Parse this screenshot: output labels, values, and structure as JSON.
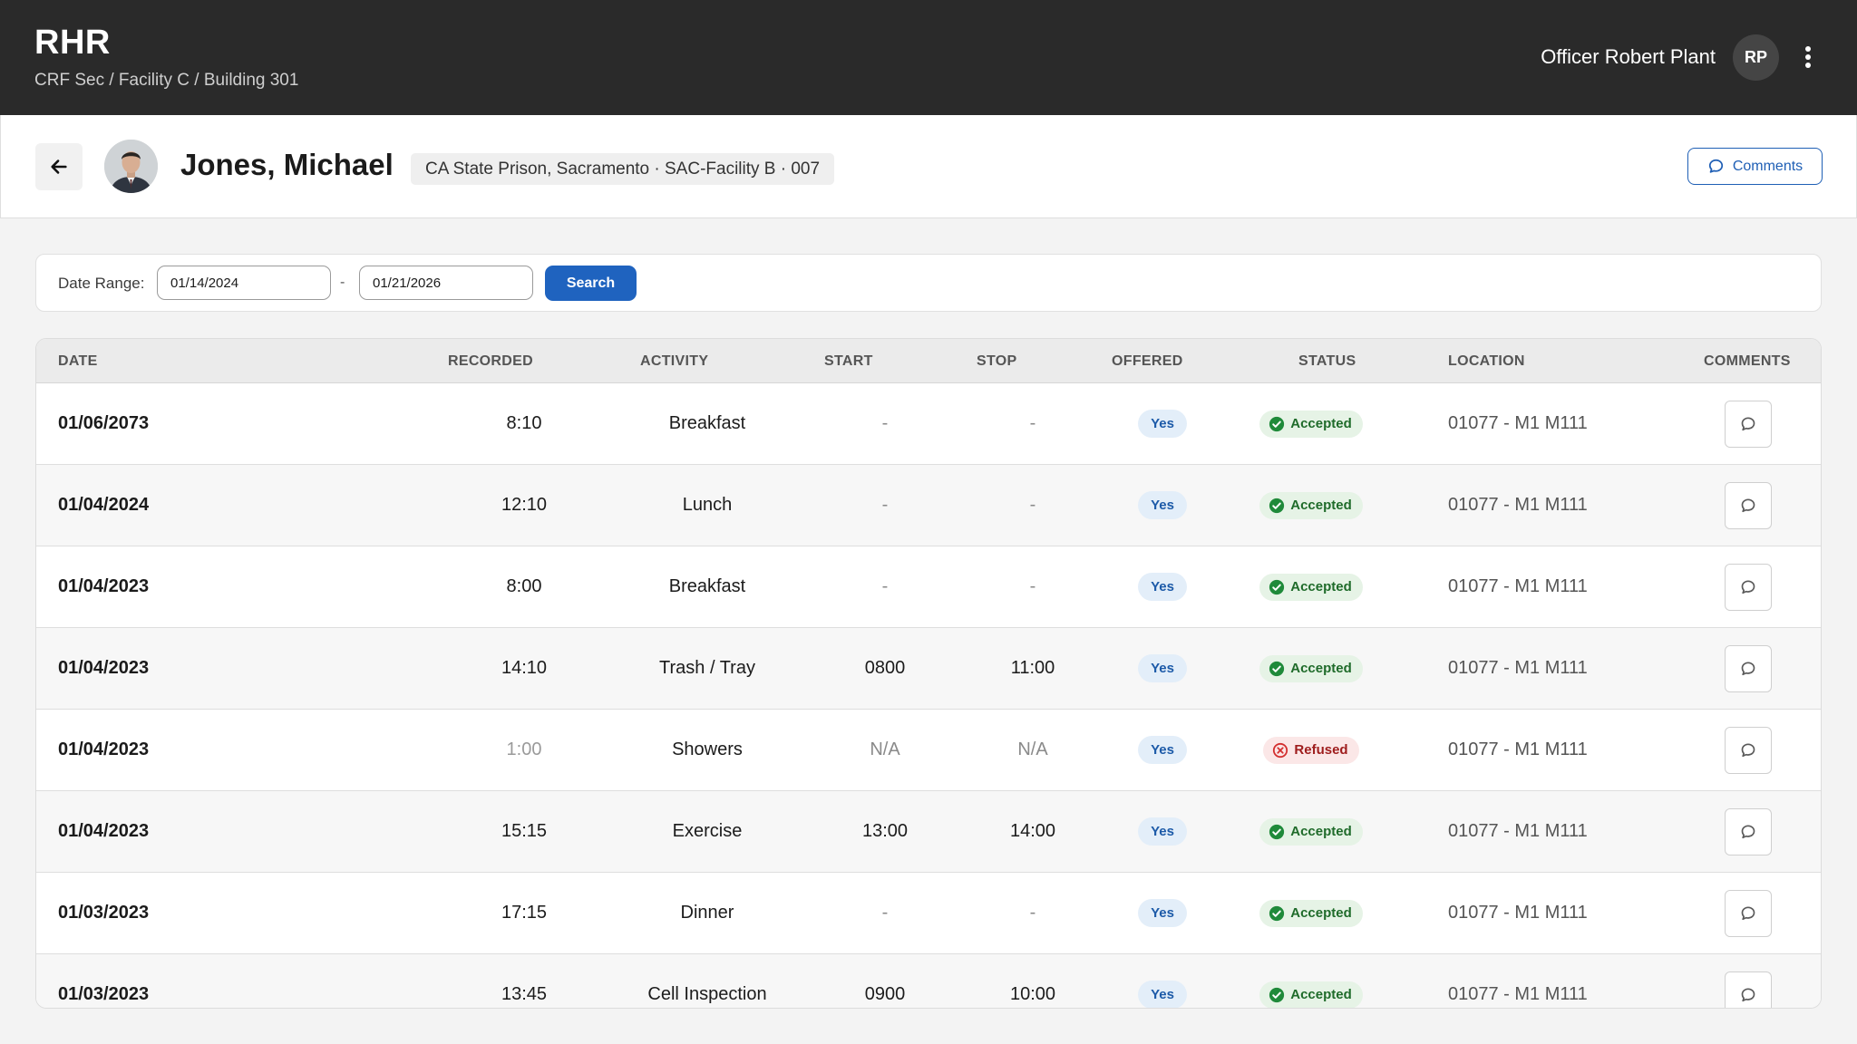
{
  "app": {
    "title": "RHR",
    "breadcrumb": "CRF Sec / Facility C / Building 301",
    "user_name": "Officer Robert Plant",
    "user_initials": "RP"
  },
  "person": {
    "name": "Jones, Michael",
    "facility": "CA State Prison, Sacramento · SAC-Facility B · 007",
    "comments_label": "Comments"
  },
  "filter": {
    "label": "Date Range:",
    "from": "01/14/2024",
    "separator": "-",
    "to": "01/21/2026",
    "search_label": "Search"
  },
  "table": {
    "columns": [
      "DATE",
      "RECORDED",
      "ACTIVITY",
      "START",
      "STOP",
      "OFFERED",
      "STATUS",
      "LOCATION",
      "COMMENTS"
    ],
    "rows": [
      {
        "date": "01/06/2073",
        "recorded": "8:10",
        "activity": "Breakfast",
        "start": "-",
        "stop": "-",
        "offered": "Yes",
        "status": "Accepted",
        "location": "01077 - M1 M111"
      },
      {
        "date": "01/04/2024",
        "recorded": "12:10",
        "activity": "Lunch",
        "start": "-",
        "stop": "-",
        "offered": "Yes",
        "status": "Accepted",
        "location": "01077 - M1 M111"
      },
      {
        "date": "01/04/2023",
        "recorded": "8:00",
        "activity": "Breakfast",
        "start": "-",
        "stop": "-",
        "offered": "Yes",
        "status": "Accepted",
        "location": "01077 - M1 M111"
      },
      {
        "date": "01/04/2023",
        "recorded": "14:10",
        "activity": "Trash / Tray",
        "start": "0800",
        "stop": "11:00",
        "offered": "Yes",
        "status": "Accepted",
        "location": "01077 - M1 M111"
      },
      {
        "date": "01/04/2023",
        "recorded": "1:00",
        "activity": "Showers",
        "start": "N/A",
        "stop": "N/A",
        "offered": "Yes",
        "status": "Refused",
        "location": "01077 - M1 M111"
      },
      {
        "date": "01/04/2023",
        "recorded": "15:15",
        "activity": "Exercise",
        "start": "13:00",
        "stop": "14:00",
        "offered": "Yes",
        "status": "Accepted",
        "location": "01077 - M1 M111"
      },
      {
        "date": "01/03/2023",
        "recorded": "17:15",
        "activity": "Dinner",
        "start": "-",
        "stop": "-",
        "offered": "Yes",
        "status": "Accepted",
        "location": "01077 - M1 M111"
      },
      {
        "date": "01/03/2023",
        "recorded": "13:45",
        "activity": "Cell Inspection",
        "start": "0900",
        "stop": "10:00",
        "offered": "Yes",
        "status": "Accepted",
        "location": "01077 - M1 M111"
      }
    ]
  },
  "colors": {
    "appbar": "#2a2a2a",
    "accent": "#1f63bf",
    "accepted": "#1f8a3a",
    "refused": "#d32f2f"
  },
  "icons": {
    "back": "arrow-left-icon",
    "menu": "more-vertical-icon",
    "comment": "comment-bubble-icon",
    "accepted": "check-circle-icon",
    "refused": "x-circle-icon"
  }
}
